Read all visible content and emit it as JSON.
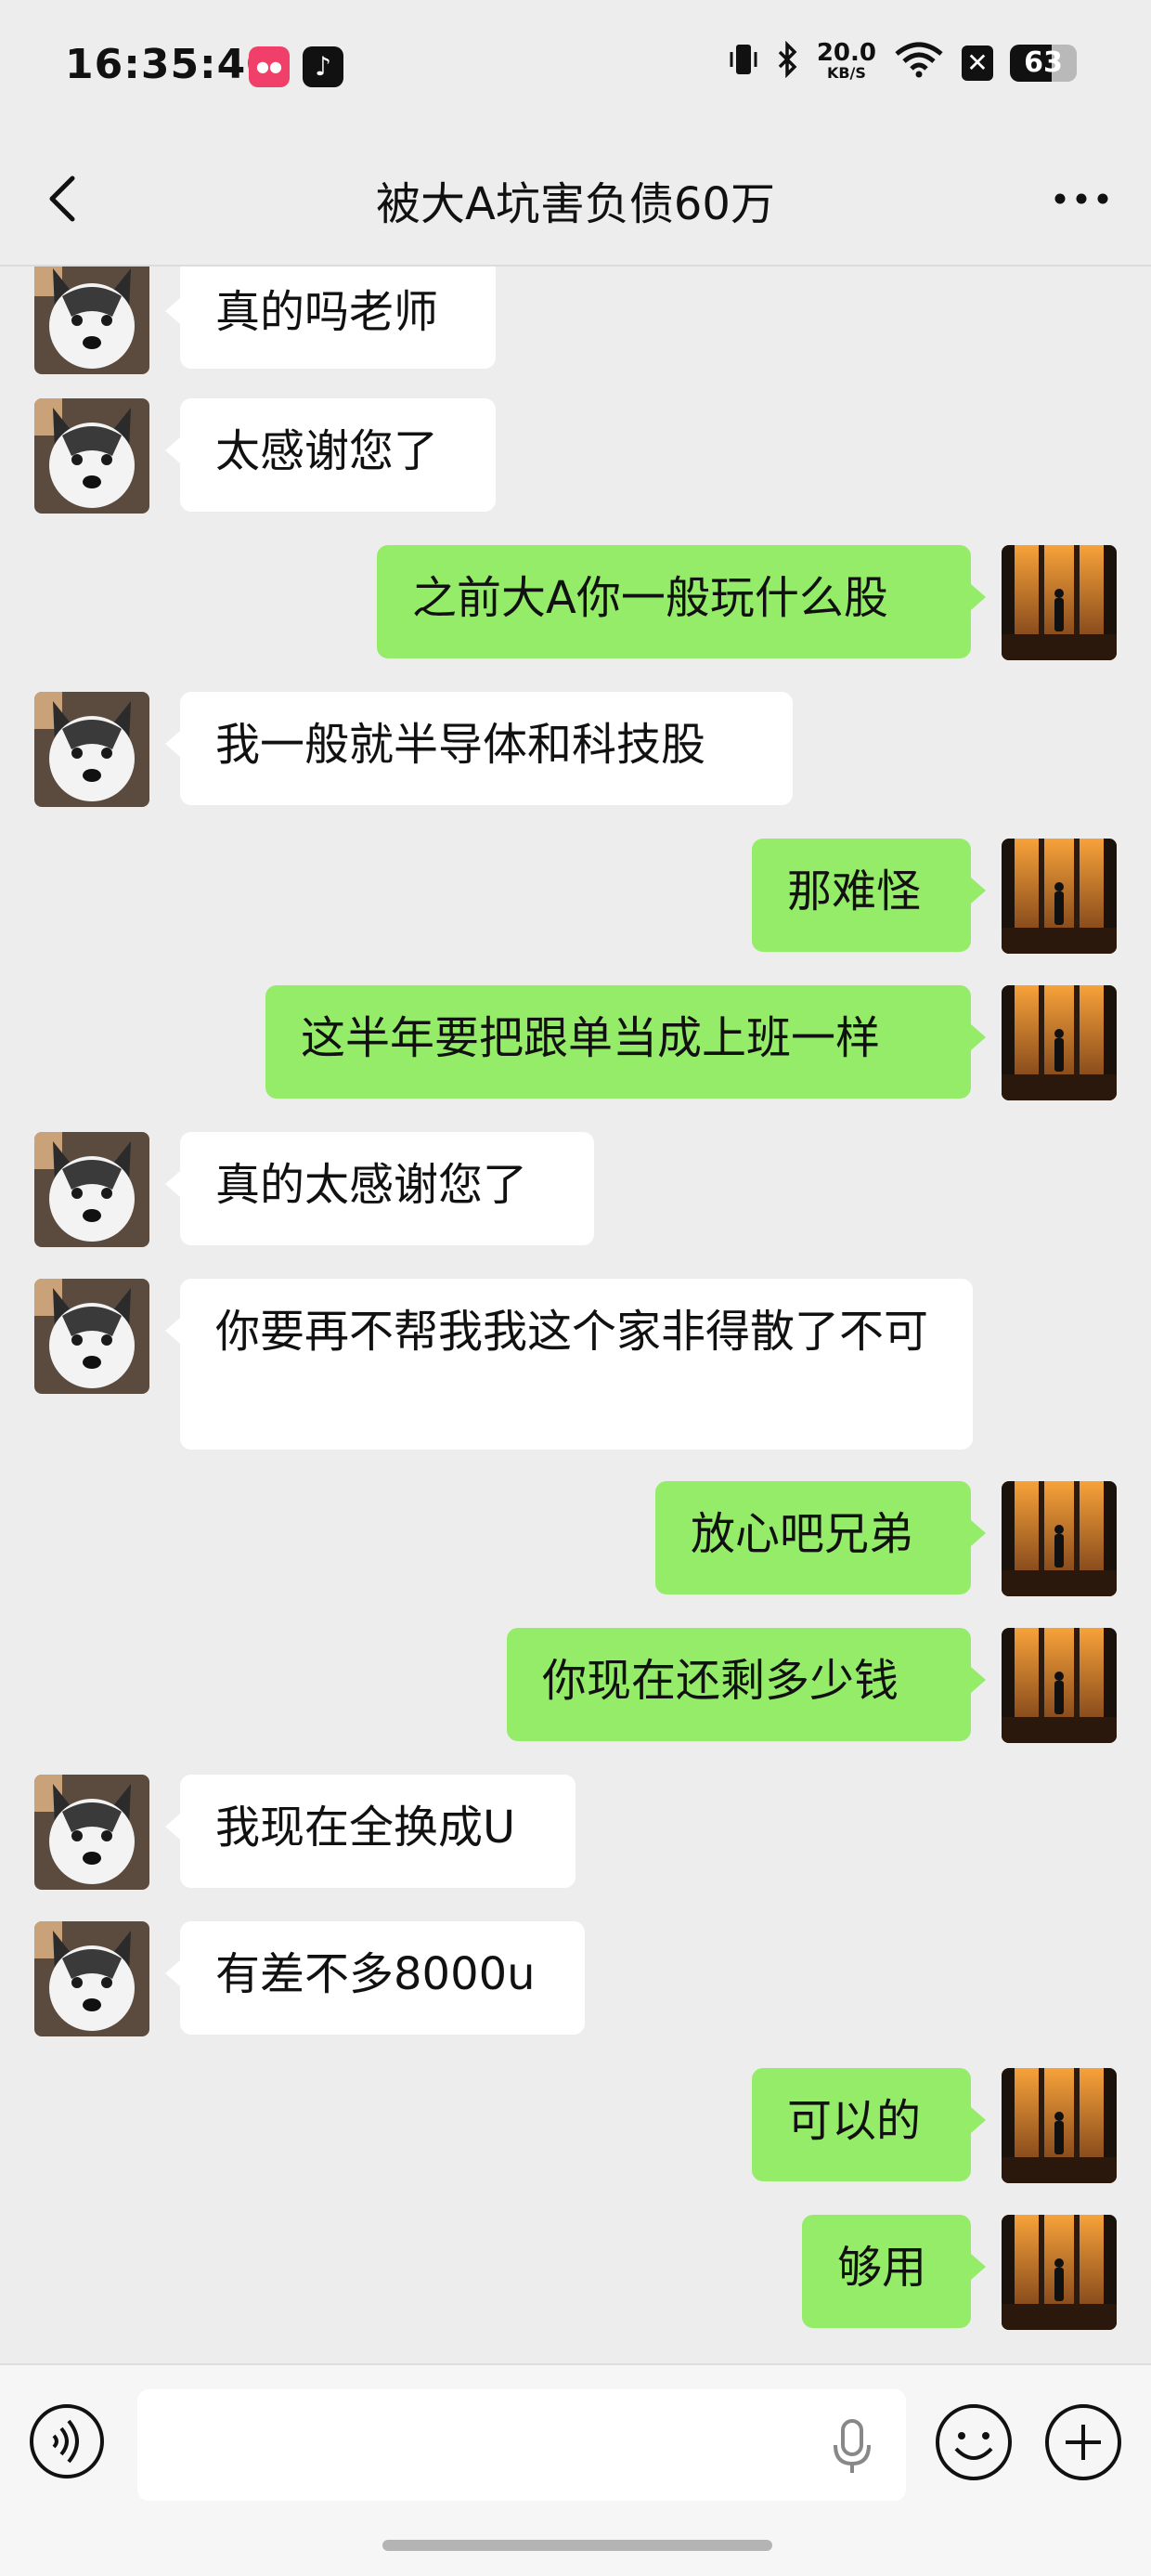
{
  "status_bar": {
    "time": "16:35:40",
    "net_speed_value": "20.0",
    "net_speed_unit": "KB/S",
    "battery": "63"
  },
  "header": {
    "title": "被大A坑害负债60万"
  },
  "messages": [
    {
      "side": "left",
      "text": "真的吗老师"
    },
    {
      "side": "left",
      "text": "太感谢您了"
    },
    {
      "side": "right",
      "text": "之前大A你一般玩什么股"
    },
    {
      "side": "left",
      "text": "我一般就半导体和科技股"
    },
    {
      "side": "right",
      "text": "那难怪"
    },
    {
      "side": "right",
      "text": "这半年要把跟单当成上班一样"
    },
    {
      "side": "left",
      "text": "真的太感谢您了"
    },
    {
      "side": "left",
      "text": "你要再不帮我我这个家非得散了不可"
    },
    {
      "side": "right",
      "text": "放心吧兄弟"
    },
    {
      "side": "right",
      "text": "你现在还剩多少钱"
    },
    {
      "side": "left",
      "text": "我现在全换成U"
    },
    {
      "side": "left",
      "text": "有差不多8000u"
    },
    {
      "side": "right",
      "text": "可以的"
    },
    {
      "side": "right",
      "text": "够用"
    }
  ],
  "input_bar": {
    "value": "",
    "placeholder": ""
  }
}
